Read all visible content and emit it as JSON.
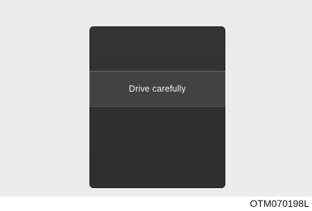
{
  "display": {
    "message": "Drive carefully"
  },
  "figure": {
    "code": "OTM070198L"
  }
}
